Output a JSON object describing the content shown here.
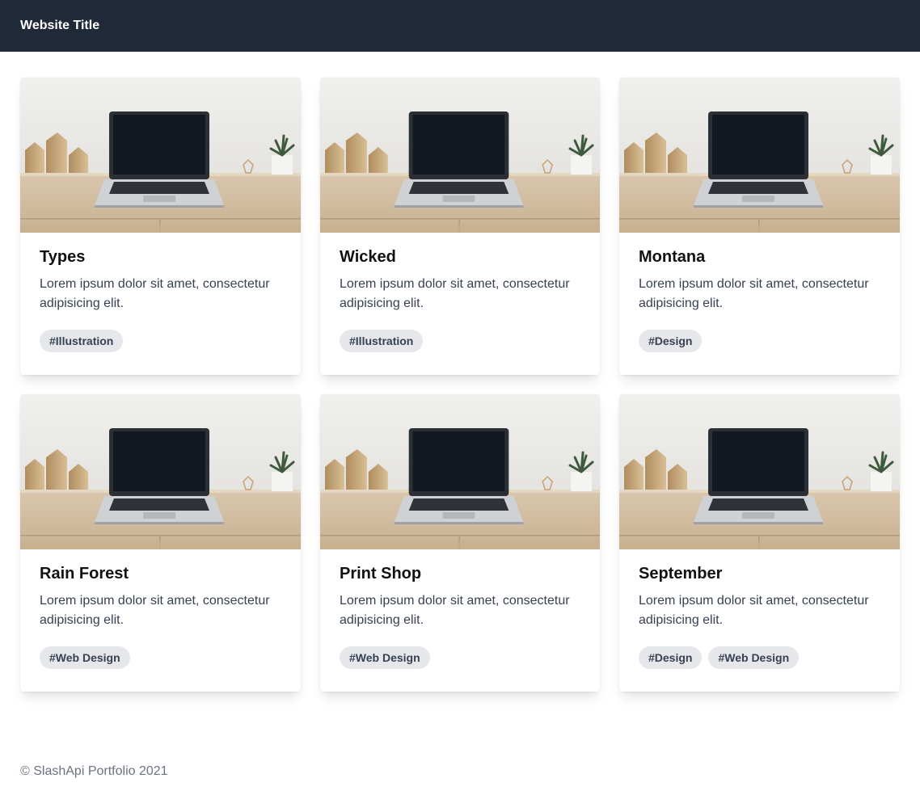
{
  "header": {
    "title": "Website Title"
  },
  "cards": [
    {
      "title": "Types",
      "description": "Lorem ipsum dolor sit amet, consectetur adipisicing elit.",
      "tags": [
        "#Illustration"
      ]
    },
    {
      "title": "Wicked",
      "description": "Lorem ipsum dolor sit amet, consectetur adipisicing elit.",
      "tags": [
        "#Illustration"
      ]
    },
    {
      "title": "Montana",
      "description": "Lorem ipsum dolor sit amet, consectetur adipisicing elit.",
      "tags": [
        "#Design"
      ]
    },
    {
      "title": "Rain Forest",
      "description": "Lorem ipsum dolor sit amet, consectetur adipisicing elit.",
      "tags": [
        "#Web Design"
      ]
    },
    {
      "title": "Print Shop",
      "description": "Lorem ipsum dolor sit amet, consectetur adipisicing elit.",
      "tags": [
        "#Web Design"
      ]
    },
    {
      "title": "September",
      "description": "Lorem ipsum dolor sit amet, consectetur adipisicing elit.",
      "tags": [
        "#Design",
        "#Web Design"
      ]
    }
  ],
  "footer": {
    "text": "© SlashApi Portfolio 2021"
  },
  "colors": {
    "header_bg": "#1f2937",
    "tag_bg": "#e5e7eb",
    "tag_text": "#374151",
    "body_text": "#374151",
    "footer_text": "#6b7280"
  },
  "image": {
    "subject": "laptop-on-desk-photo"
  }
}
